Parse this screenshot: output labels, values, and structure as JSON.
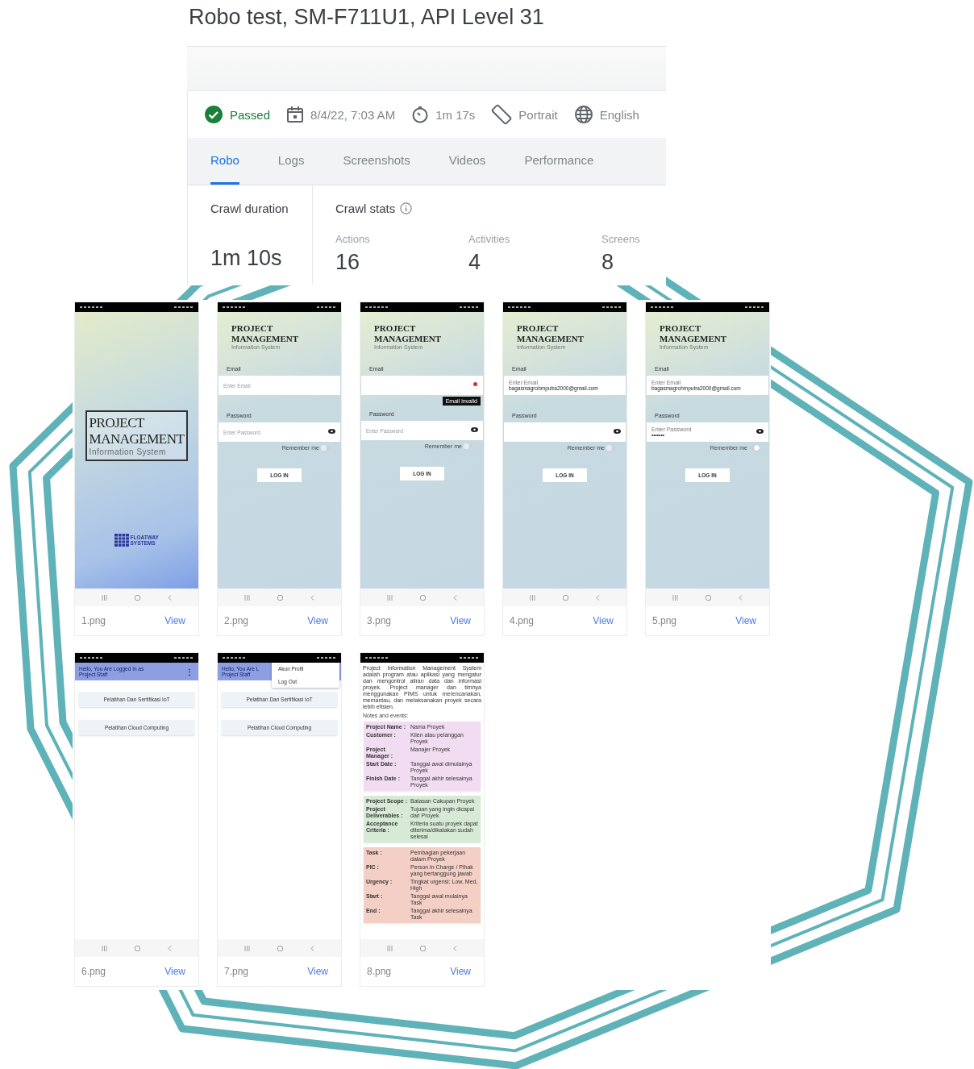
{
  "page_title": "Robo test, SM-F711U1, API Level 31",
  "summary": {
    "status": "Passed",
    "date": "8/4/22, 7:03 AM",
    "duration": "1m 17s",
    "orientation": "Portrait",
    "locale": "English"
  },
  "tabs": [
    {
      "label": "Robo",
      "selected": true
    },
    {
      "label": "Logs",
      "selected": false
    },
    {
      "label": "Screenshots",
      "selected": false
    },
    {
      "label": "Videos",
      "selected": false
    },
    {
      "label": "Performance",
      "selected": false
    }
  ],
  "crawl_duration": {
    "label": "Crawl duration",
    "value": "1m 10s"
  },
  "crawl_stats": {
    "label": "Crawl stats",
    "stats": [
      {
        "label": "Actions",
        "value": "16"
      },
      {
        "label": "Activities",
        "value": "4"
      },
      {
        "label": "Screens",
        "value": "8"
      }
    ]
  },
  "screenshots": [
    {
      "file": "1.png",
      "link": "View",
      "screen": {
        "kind": "splash",
        "title_lines": [
          "PROJECT",
          "MANAGEMENT"
        ],
        "subtitle": "Information System",
        "logo": "FLOATWAY SYSTEMS"
      }
    },
    {
      "file": "2.png",
      "link": "View",
      "screen": {
        "kind": "login",
        "title_lines": [
          "PROJECT",
          "MANAGEMENT"
        ],
        "subtitle": "Information System",
        "email_label": "Email",
        "email_placeholder": "Enter Email",
        "password_label": "Password",
        "password_placeholder": "Enter Password",
        "remember": "Remember me",
        "remember_on": false,
        "button": "LOG IN"
      }
    },
    {
      "file": "3.png",
      "link": "View",
      "screen": {
        "kind": "login",
        "title_lines": [
          "PROJECT",
          "MANAGEMENT"
        ],
        "subtitle": "Information System",
        "email_label": "Email",
        "email_error": "Email invalid",
        "password_label": "Password",
        "password_placeholder": "Enter Password",
        "remember": "Remember me",
        "remember_on": false,
        "button": "LOG IN"
      }
    },
    {
      "file": "4.png",
      "link": "View",
      "screen": {
        "kind": "login",
        "title_lines": [
          "PROJECT",
          "MANAGEMENT"
        ],
        "subtitle": "Information System",
        "email_label": "Email",
        "email_float": "Enter Email",
        "email_value": "bagasmagrohmputra2000@gmail.com",
        "password_label": "Password",
        "remember": "Remember me",
        "remember_on": false,
        "button": "LOG IN"
      }
    },
    {
      "file": "5.png",
      "link": "View",
      "screen": {
        "kind": "login",
        "title_lines": [
          "PROJECT",
          "MANAGEMENT"
        ],
        "subtitle": "Information System",
        "email_label": "Email",
        "email_float": "Enter Email",
        "email_value": "bagasmagrohmputra2000@gmail.com",
        "password_label": "Password",
        "password_float": "Enter Password",
        "password_value": "•••••••",
        "remember": "Remember me",
        "remember_on": true,
        "button": "LOG IN"
      }
    },
    {
      "file": "6.png",
      "link": "View",
      "screen": {
        "kind": "home",
        "header_lines": [
          "Hello, You Are Logged In as",
          "Project Staff"
        ],
        "header_menu": "⋮",
        "items": [
          "Pelatihan Dan Sertifikasi IoT",
          "Pelatihan Cloud Computing"
        ]
      }
    },
    {
      "file": "7.png",
      "link": "View",
      "screen": {
        "kind": "home",
        "header_lines": [
          "Hello, You Are L",
          "Project Staff"
        ],
        "menu": [
          "Akun Profil",
          "Log Out"
        ],
        "items": [
          "Pelatihan Dan Sertifikasi IoT",
          "Pelatihan Cloud Computing"
        ]
      }
    },
    {
      "file": "8.png",
      "link": "View",
      "screen": {
        "kind": "info",
        "paragraph": "Project Information Management System adalah program atau aplikasi yang mengatur dan mengontrol aliran data dan informasi proyek. Project manager dan timnya menggunakan PIMS untuk merencanakan, memantau, dan melaksanakan proyek secara lebih efisien.",
        "note": "Notes and events:",
        "sections": [
          {
            "color": "#f1dcf1",
            "rows": [
              {
                "label": "Project Name :",
                "value": "Nama Proyek"
              },
              {
                "label": "Customer :",
                "value": "Klien atau pelanggan Proyek"
              },
              {
                "label": "Project Manager :",
                "value": "Manajer Proyek"
              },
              {
                "label": "Start Date :",
                "value": "Tanggal awal dimulainya Proyek"
              },
              {
                "label": "Finish Date :",
                "value": "Tanggal akhir selesainya Proyek"
              }
            ]
          },
          {
            "color": "#d6ead6",
            "rows": [
              {
                "label": "Project Scope :",
                "value": "Batasan Cakupan Proyek"
              },
              {
                "label": "Project Deliverables :",
                "value": "Tujuan yang ingin dicapai dari Proyek"
              },
              {
                "label": "Acceptance Criteria :",
                "value": "Kriteria suatu proyek dapat diterima/dikatakan sudah selesai"
              }
            ]
          },
          {
            "color": "#f3cfc6",
            "rows": [
              {
                "label": "Task :",
                "value": "Pembagian pekerjaan dalam Proyek"
              },
              {
                "label": "PIC :",
                "value": "Person in Charge / Pihak yang bertanggung jawab"
              },
              {
                "label": "Urgency :",
                "value": "Tingkat urgensi: Low, Med, High"
              },
              {
                "label": "Start :",
                "value": "Tanggal awal mulainya Task"
              },
              {
                "label": "End :",
                "value": "Tanggal akhir selesainya Task"
              }
            ]
          }
        ]
      }
    }
  ]
}
